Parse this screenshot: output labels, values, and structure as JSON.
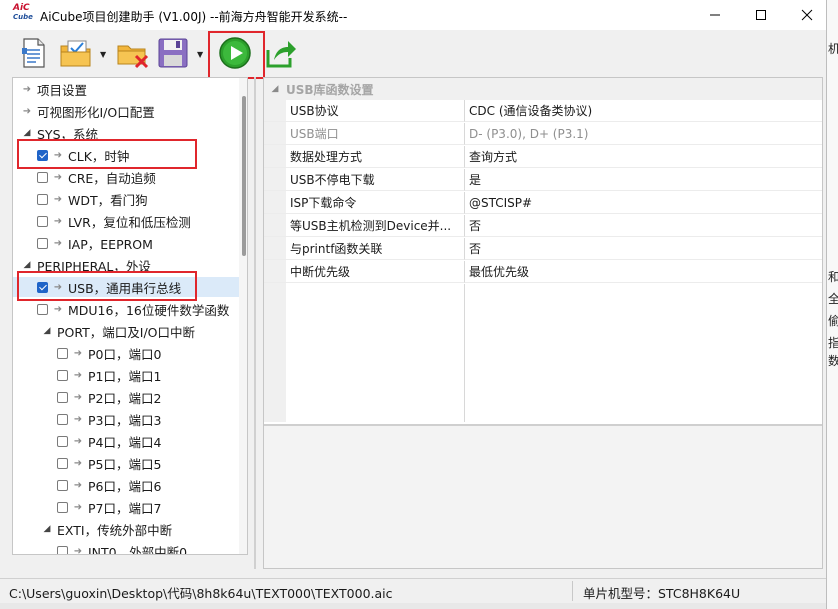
{
  "window": {
    "logo_top": "AiC",
    "logo_bottom": "Cube",
    "title": "AiCube项目创建助手 (V1.00J) --前海方舟智能开发系统--"
  },
  "toolbar": {
    "buttons": [
      "new-project-icon",
      "open-folder-icon",
      "close-project-icon",
      "save-icon",
      "run-icon",
      "export-icon"
    ]
  },
  "tree": {
    "items": [
      {
        "label": "项目设置"
      },
      {
        "label": "可视图形化I/O口配置"
      },
      {
        "label": "SYS，系统"
      },
      {
        "label": "CLK，时钟",
        "checked": true
      },
      {
        "label": "CRE，自动追频",
        "checked": false
      },
      {
        "label": "WDT，看门狗",
        "checked": false
      },
      {
        "label": "LVR，复位和低压检测",
        "checked": false
      },
      {
        "label": "IAP，EEPROM",
        "checked": false
      },
      {
        "label": "PERIPHERAL，外设"
      },
      {
        "label": "USB，通用串行总线",
        "checked": true,
        "selected": true
      },
      {
        "label": "MDU16，16位硬件数学函数",
        "checked": false
      },
      {
        "label": "PORT，端口及I/O口中断"
      },
      {
        "label": "P0口，端口0",
        "checked": false
      },
      {
        "label": "P1口，端口1",
        "checked": false
      },
      {
        "label": "P2口，端口2",
        "checked": false
      },
      {
        "label": "P3口，端口3",
        "checked": false
      },
      {
        "label": "P4口，端口4",
        "checked": false
      },
      {
        "label": "P5口，端口5",
        "checked": false
      },
      {
        "label": "P6口，端口6",
        "checked": false
      },
      {
        "label": "P7口，端口7",
        "checked": false
      },
      {
        "label": "EXTI，传统外部中断"
      },
      {
        "label": "INT0，外部中断0",
        "checked": false
      }
    ]
  },
  "properties": {
    "section_title": "USB库函数设置",
    "rows": [
      {
        "key": "USB协议",
        "value": "CDC (通信设备类协议)"
      },
      {
        "key": "USB端口",
        "value": "D- (P3.0), D+ (P3.1)",
        "dim": true
      },
      {
        "key": "数据处理方式",
        "value": "查询方式"
      },
      {
        "key": "USB不停电下载",
        "value": "是"
      },
      {
        "key": "ISP下载命令",
        "value": "@STCISP#"
      },
      {
        "key": "等USB主机检测到Device并...",
        "value": "否"
      },
      {
        "key": "与printf函数关联",
        "value": "否"
      },
      {
        "key": "中断优先级",
        "value": "最低优先级"
      }
    ]
  },
  "status": {
    "path": "C:\\Users\\guoxin\\Desktop\\代码\\8h8k64u\\TEXT000\\TEXT000.aic",
    "model": "单片机型号：STC8H8K64U"
  },
  "background_right": [
    "机",
    "和",
    "全",
    "偷",
    "指",
    "数"
  ],
  "colors": {
    "highlight_box": "#e0262c",
    "run_button": "#2ca02c",
    "checkbox_checked": "#1f64c8",
    "selection": "#dbeaf9"
  }
}
